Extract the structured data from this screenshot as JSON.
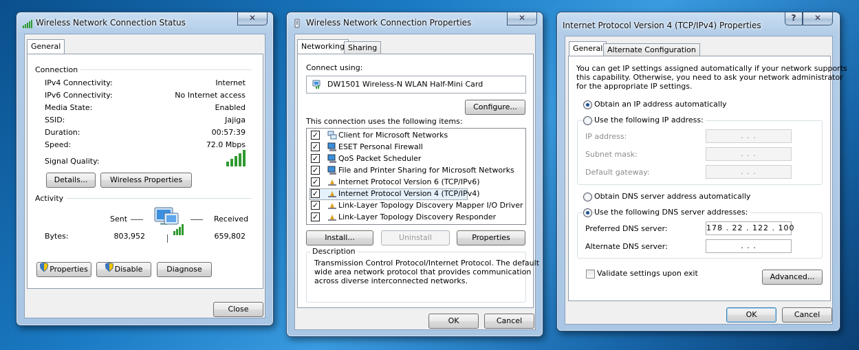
{
  "status_window": {
    "title": "Wireless Network Connection Status",
    "close_label": "✕",
    "tab": "General",
    "connection_heading": "Connection",
    "rows": [
      {
        "label": "IPv4 Connectivity:",
        "value": "Internet"
      },
      {
        "label": "IPv6 Connectivity:",
        "value": "No Internet access"
      },
      {
        "label": "Media State:",
        "value": "Enabled"
      },
      {
        "label": "SSID:",
        "value": "Jajiga"
      },
      {
        "label": "Duration:",
        "value": "00:57:39"
      },
      {
        "label": "Speed:",
        "value": "72.0 Mbps"
      }
    ],
    "signal_label": "Signal Quality:",
    "details_button": "Details...",
    "wireless_properties_button": "Wireless Properties",
    "activity_heading": "Activity",
    "sent_label": "Sent",
    "received_label": "Received",
    "bytes_label": "Bytes:",
    "bytes_sent": "803,952",
    "bytes_received": "659,802",
    "properties_button": "Properties",
    "disable_button": "Disable",
    "diagnose_button": "Diagnose",
    "close_button": "Close"
  },
  "properties_window": {
    "title": "Wireless Network Connection Properties",
    "close_label": "✕",
    "tabs": [
      "Networking",
      "Sharing"
    ],
    "connect_using_label": "Connect using:",
    "adapter_name": "DW1501 Wireless-N WLAN Half-Mini Card",
    "configure_button": "Configure...",
    "items_label": "This connection uses the following items:",
    "items": [
      {
        "label": "Client for Microsoft Networks",
        "checked": true,
        "icon": "network-client-icon"
      },
      {
        "label": "ESET Personal Firewall",
        "checked": true,
        "icon": "network-service-icon"
      },
      {
        "label": "QoS Packet Scheduler",
        "checked": true,
        "icon": "network-service-icon"
      },
      {
        "label": "File and Printer Sharing for Microsoft Networks",
        "checked": true,
        "icon": "network-service-icon"
      },
      {
        "label": "Internet Protocol Version 6 (TCP/IPv6)",
        "checked": true,
        "icon": "protocol-icon"
      },
      {
        "label": "Internet Protocol Version 4 (TCP/IPv4)",
        "checked": true,
        "icon": "protocol-icon",
        "selected": true
      },
      {
        "label": "Link-Layer Topology Discovery Mapper I/O Driver",
        "checked": true,
        "icon": "protocol-icon"
      },
      {
        "label": "Link-Layer Topology Discovery Responder",
        "checked": true,
        "icon": "protocol-icon"
      }
    ],
    "install_button": "Install...",
    "uninstall_button": "Uninstall",
    "properties_button": "Properties",
    "description_heading": "Description",
    "description_text": [
      "Transmission Control Protocol/Internet Protocol. The default",
      "wide area network protocol that provides communication",
      "across diverse interconnected networks."
    ],
    "ok_button": "OK",
    "cancel_button": "Cancel"
  },
  "ipv4_window": {
    "title": "Internet Protocol Version 4 (TCP/IPv4) Properties",
    "help_label": "?",
    "close_label": "✕",
    "tabs": [
      "General",
      "Alternate Configuration"
    ],
    "intro": [
      "You can get IP settings assigned automatically if your network supports",
      "this capability. Otherwise, you need to ask your network administrator",
      "for the appropriate IP settings."
    ],
    "obtain_ip_auto": "Obtain an IP address automatically",
    "use_following_ip": "Use the following IP address:",
    "ip_address_label": "IP address:",
    "subnet_mask_label": "Subnet mask:",
    "default_gateway_label": "Default gateway:",
    "empty_ip": ".       .       .",
    "obtain_dns_auto": "Obtain DNS server address automatically",
    "use_following_dns": "Use the following DNS server addresses:",
    "preferred_dns_label": "Preferred DNS server:",
    "preferred_dns_value": "178 .  22  . 122 . 100",
    "alternate_dns_label": "Alternate DNS server:",
    "alternate_dns_value": ".       .       .",
    "validate_label": "Validate settings upon exit",
    "advanced_button": "Advanced...",
    "ok_button": "OK",
    "cancel_button": "Cancel",
    "ip_mode": "auto",
    "dns_mode": "manual",
    "validate_checked": false
  },
  "colors": {
    "accent": "#3c7fb1",
    "signal_green": "#2f9a2f",
    "selection": "#e5f1fb"
  }
}
